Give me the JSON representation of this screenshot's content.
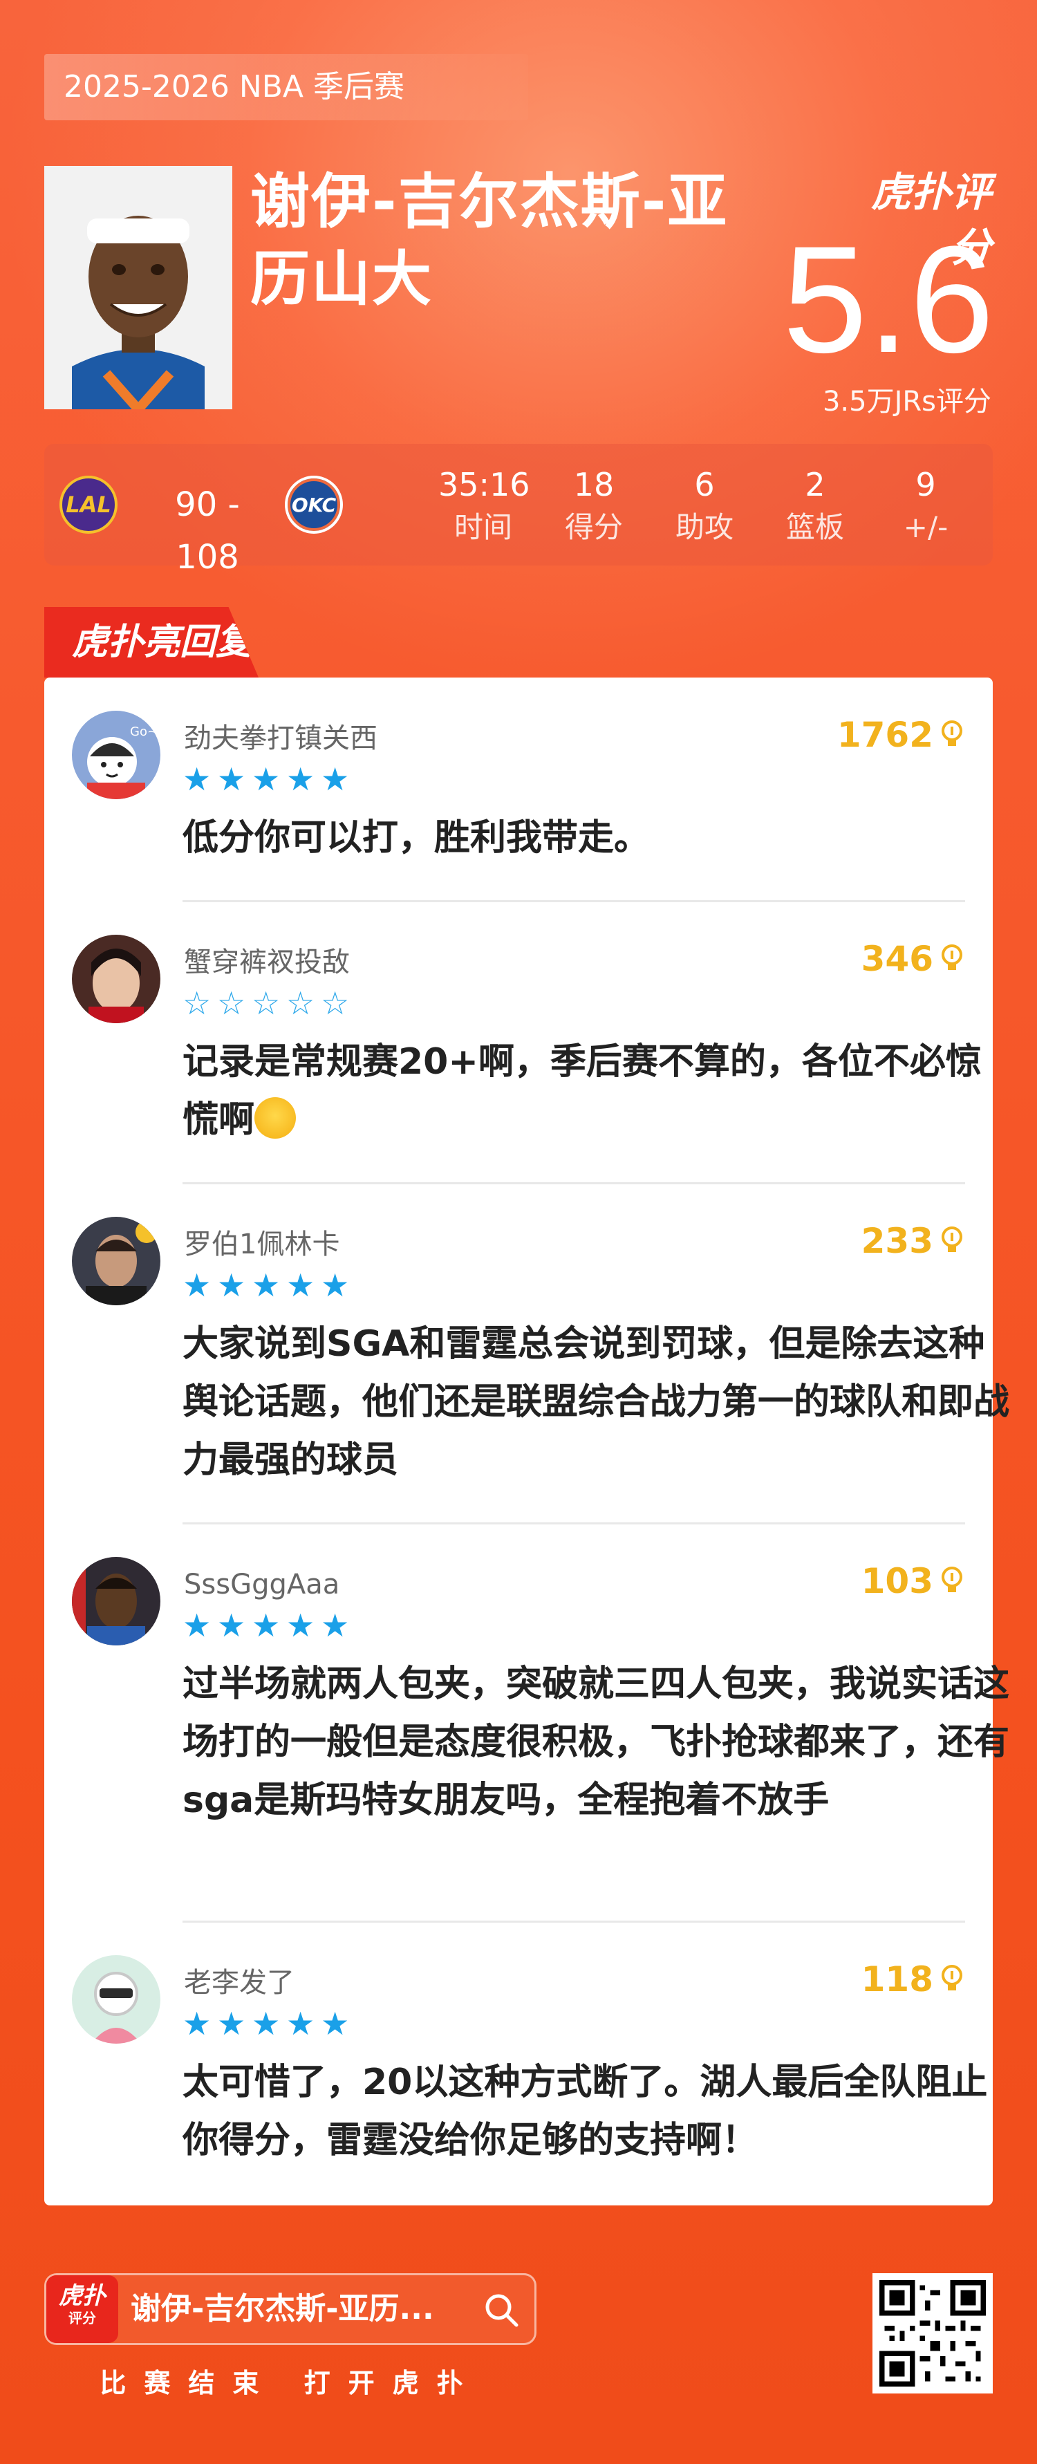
{
  "header": {
    "season": "2025-2026 NBA 季后赛",
    "player_name": "谢伊-吉尔杰斯-亚历山大",
    "brand": "虎扑评分",
    "rating": "5.6",
    "rating_count": "3.5万JRs评分"
  },
  "game": {
    "home_team_icon": "lakers-logo",
    "away_team_icon": "thunder-logo",
    "home_abbr": "LAL",
    "away_abbr": "OKC",
    "score": "90 - 108",
    "stats": [
      {
        "value": "35:16",
        "label": "时间"
      },
      {
        "value": "18",
        "label": "得分"
      },
      {
        "value": "6",
        "label": "助攻"
      },
      {
        "value": "2",
        "label": "篮板"
      },
      {
        "value": "9",
        "label": "+/-"
      }
    ]
  },
  "section": {
    "title": "虎扑亮回复"
  },
  "comments": [
    {
      "user": "劲夫拳打镇关西",
      "stars": 5,
      "likes": "1762",
      "text": "低分你可以打，胜利我带走。",
      "avatar": "cartoon-avatar"
    },
    {
      "user": "蟹穿裤衩投敌",
      "stars": 0,
      "likes": "346",
      "text": "记录是常规赛20+啊，季后赛不算的，各位不必惊慌啊",
      "avatar": "photo-avatar"
    },
    {
      "user": "罗伯1佩林卡",
      "stars": 5,
      "likes": "233",
      "text": "大家说到SGA和雷霆总会说到罚球，但是除去这种舆论话题，他们还是联盟综合战力第一的球队和即战力最强的球员",
      "avatar": "photo-avatar"
    },
    {
      "user": "SssGggAaa",
      "stars": 5,
      "likes": "103",
      "text": "过半场就两人包夹，突破就三四人包夹，我说实话这场打的一般但是态度很积极，飞扑抢球都来了，还有sga是斯玛特女朋友吗，全程抱着不放手",
      "avatar": "photo-avatar"
    },
    {
      "user": "老李发了",
      "stars": 5,
      "likes": "118",
      "text": "太可惜了，20以这种方式断了。湖人最后全队阻止你得分，雷霆没给你足够的支持啊！",
      "avatar": "default-avatar"
    }
  ],
  "footer": {
    "app_icon_text": "虎扑",
    "app_icon_sub": "评分",
    "search_text": "谢伊-吉尔杰斯-亚历...",
    "cta": "比赛结束 打开虎扑",
    "qr": "qr-code"
  },
  "colors": {
    "background": "#f75a2e",
    "star": "#1aa0e8",
    "likes": "#f2b21d",
    "accent_red": "#ea2b1f"
  }
}
